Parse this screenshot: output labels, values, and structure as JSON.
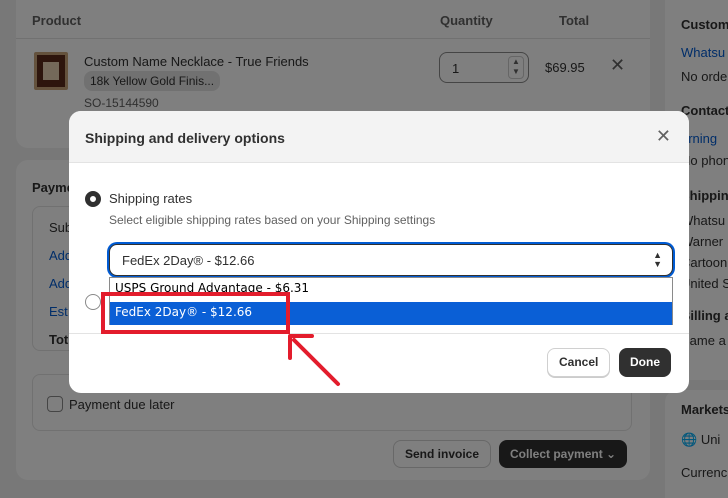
{
  "products": {
    "header": {
      "product": "Product",
      "quantity": "Quantity",
      "total": "Total"
    },
    "item": {
      "name": "Custom Name Necklace - True Friends",
      "variant": "18k Yellow Gold Finis...",
      "sku": "SO-15144590",
      "quantity": "1",
      "price": "$69.95"
    }
  },
  "payment": {
    "title": "Payme",
    "rows": [
      "Sub",
      "Add",
      "Add",
      "Est",
      "Tot"
    ],
    "due_later_label": "Payment due later",
    "send_invoice": "Send invoice",
    "collect_payment": "Collect payment"
  },
  "sidebar": {
    "customer_heading": "Custom",
    "customer_link": "Whatsu",
    "no_orders": "No orde",
    "contact_heading": "Contact",
    "contact_email": "orning",
    "no_phone": "No phon",
    "shipping_heading": "Shipping",
    "address": [
      "Whatsu",
      "Warner",
      "Cartoon",
      "United S"
    ],
    "billing_heading": "Billing ad",
    "billing_same": "Same a",
    "markets_heading": "Markets",
    "market_value": "Uni",
    "currency_label": "Currenc"
  },
  "modal": {
    "title": "Shipping and delivery options",
    "option_label": "Shipping rates",
    "option_help": "Select eligible shipping rates based on your Shipping settings",
    "selected_rate": "FedEx 2Day® - $12.66",
    "dropdown_options": [
      "USPS Ground Advantage - $6.31",
      "FedEx 2Day® - $12.66"
    ],
    "cancel": "Cancel",
    "done": "Done"
  },
  "colors": {
    "accent": "#005bd3",
    "annotation": "#e31c2c",
    "primary_button": "#303030",
    "selected_option": "#0a5fd6"
  }
}
